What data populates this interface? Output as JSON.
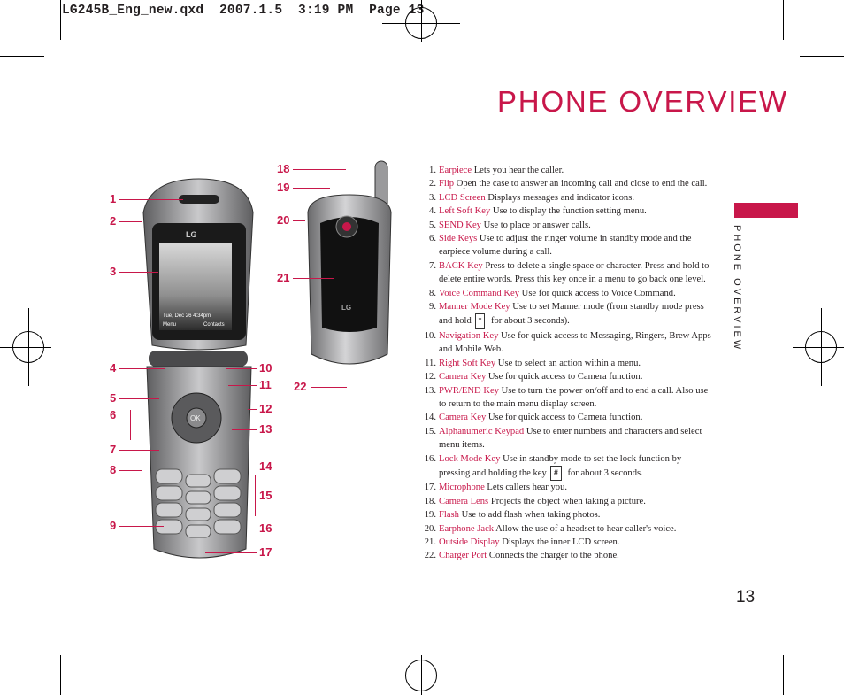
{
  "slug": "LG245B_Eng_new.qxd  2007.1.5  3:19 PM  Page 13",
  "title": "PHONE OVERVIEW",
  "side_tab": "PHONE OVERVIEW",
  "page_number": "13",
  "accent_color": "#c8174a",
  "callouts_open": [
    "1",
    "2",
    "3",
    "4",
    "5",
    "6",
    "7",
    "8",
    "9",
    "10",
    "11",
    "12",
    "13",
    "14",
    "15",
    "16",
    "17"
  ],
  "callouts_closed": [
    "18",
    "19",
    "20",
    "21",
    "22"
  ],
  "phone_screen": {
    "status": "Tue, Dec 26  4:34pm",
    "left_soft": "Menu",
    "right_soft": "Contacts"
  },
  "items": [
    {
      "n": "1.",
      "key": "Earpiece",
      "text": " Lets you hear the caller."
    },
    {
      "n": "2.",
      "key": "Flip",
      "text": " Open the case to answer an incoming call and close to end the call."
    },
    {
      "n": "3.",
      "key": "LCD Screen",
      "text": " Displays messages and indicator icons."
    },
    {
      "n": "4.",
      "key": "Left Soft Key",
      "text": " Use to display the function setting menu."
    },
    {
      "n": "5.",
      "key": "SEND Key",
      "text": " Use to place or answer calls."
    },
    {
      "n": "6.",
      "key": "Side Keys",
      "text": " Use to adjust the ringer volume in standby mode and the earpiece volume during a call."
    },
    {
      "n": "7.",
      "key": "BACK Key",
      "text": " Press to delete a single space or character. Press and hold to delete entire words. Press this key once in a menu to go back one level."
    },
    {
      "n": "8.",
      "key": "Voice Command Key",
      "text": " Use for quick access to Voice Command."
    },
    {
      "n": "9.",
      "key": "Manner Mode Key",
      "text": " Use to set Manner mode (from standby mode press and hold",
      "keycap": "*",
      "text2": " for about 3 seconds)."
    },
    {
      "n": "10.",
      "key": "Navigation Key",
      "text": " Use for quick access to Messaging, Ringers, Brew Apps and Mobile Web."
    },
    {
      "n": "11.",
      "key": "Right Soft Key",
      "text": " Use to select an action within a menu."
    },
    {
      "n": "12.",
      "key": "Camera Key",
      "text": " Use for quick access to Camera function."
    },
    {
      "n": "13.",
      "key": "PWR/END Key",
      "text": " Use to turn the power on/off and to end a call. Also use to return to the main menu display screen."
    },
    {
      "n": "14.",
      "key": "Camera Key",
      "text": " Use for quick access to Camera function."
    },
    {
      "n": "15.",
      "key": "Alphanumeric Keypad",
      "text": " Use to enter numbers and characters and select menu items."
    },
    {
      "n": "16.",
      "key": "Lock Mode Key",
      "text": " Use in standby mode to set the lock function by pressing and holding the key",
      "keycap": "#",
      "text2": " for about 3 seconds."
    },
    {
      "n": "17.",
      "key": "Microphone",
      "text": " Lets callers hear you."
    },
    {
      "n": "18.",
      "key": "Camera Lens",
      "text": " Projects the object when taking a picture."
    },
    {
      "n": "19.",
      "key": "Flash",
      "text": " Use to add flash when taking photos."
    },
    {
      "n": "20.",
      "key": "Earphone Jack",
      "text": " Allow the use of a headset to hear caller's voice."
    },
    {
      "n": "21.",
      "key": "Outside Display",
      "text": " Displays the inner LCD screen."
    },
    {
      "n": "22.",
      "key": "Charger Port",
      "text": " Connects the charger to the phone."
    }
  ]
}
